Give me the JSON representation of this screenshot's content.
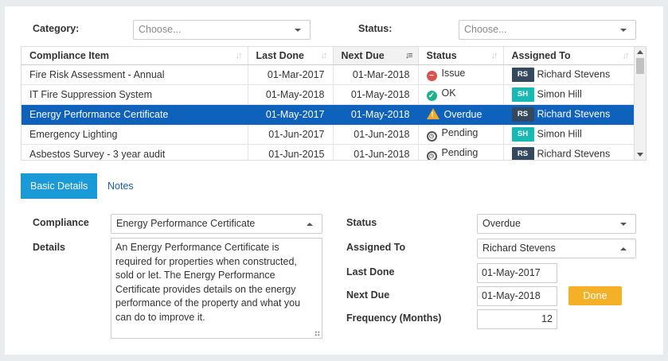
{
  "filters": {
    "category_label": "Category:",
    "category_placeholder": "Choose...",
    "status_label": "Status:",
    "status_placeholder": "Choose..."
  },
  "grid": {
    "columns": [
      "Compliance Item",
      "Last Done",
      "Next Due",
      "Status",
      "Assigned To"
    ],
    "sorted_column": "Next Due",
    "rows": [
      {
        "item": "Fire Risk Assessment - Annual",
        "last_done": "01-Mar-2017",
        "next_due": "01-Mar-2018",
        "status": "Issue",
        "status_icon": "issue-icon",
        "initials": "RS",
        "assignee": "Richard Stevens"
      },
      {
        "item": "IT Fire Suppression System",
        "last_done": "01-May-2018",
        "next_due": "01-May-2018",
        "status": "OK",
        "status_icon": "ok-check-icon",
        "initials": "SH",
        "assignee": "Simon Hill"
      },
      {
        "item": "Energy Performance Certificate",
        "last_done": "01-May-2017",
        "next_due": "01-May-2018",
        "status": "Overdue",
        "status_icon": "warning-icon",
        "initials": "RS",
        "assignee": "Richard Stevens",
        "selected": true
      },
      {
        "item": "Emergency Lighting",
        "last_done": "01-Jun-2017",
        "next_due": "01-Jun-2018",
        "status": "Pending",
        "status_icon": "clock-icon",
        "initials": "SH",
        "assignee": "Simon Hill"
      },
      {
        "item": "Asbestos Survey - 3 year audit",
        "last_done": "01-Jun-2015",
        "next_due": "01-Jun-2018",
        "status": "Pending",
        "status_icon": "clock-icon",
        "initials": "RS",
        "assignee": "Richard Stevens"
      }
    ]
  },
  "tabs": {
    "basic_details": "Basic Details",
    "notes": "Notes"
  },
  "details": {
    "compliance_label": "Compliance",
    "compliance_value": "Energy Performance Certificate",
    "details_label": "Details",
    "details_text": "An Energy Performance Certificate is required for properties when constructed, sold or let. The Energy Performance Certificate provides details on the energy performance of the property and what you can do to improve it.",
    "status_label": "Status",
    "status_value": "Overdue",
    "assigned_label": "Assigned To",
    "assigned_value": "Richard Stevens",
    "last_done_label": "Last Done",
    "last_done_value": "01-May-2017",
    "next_due_label": "Next Due",
    "next_due_value": "01-May-2018",
    "done_button": "Done",
    "frequency_label": "Frequency (Months)",
    "frequency_value": "12"
  },
  "colors": {
    "selected_row": "#0f62bc",
    "active_tab": "#1a9ad6",
    "done_button": "#f4b128",
    "issue": "#d9534f",
    "ok": "#1fb28a",
    "overdue": "#f0a92a",
    "avatar_rs": "#34495e",
    "avatar_sh": "#17b9b4"
  }
}
